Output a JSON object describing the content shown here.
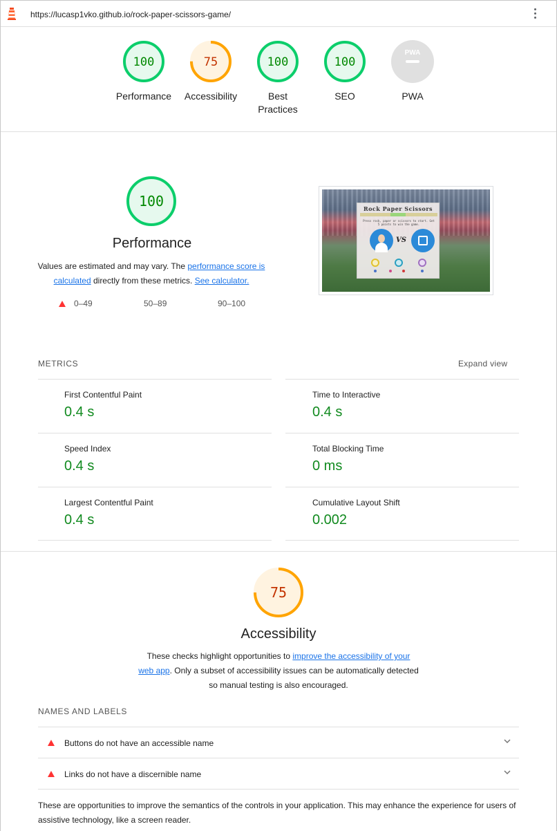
{
  "url": "https://lucasp1vko.github.io/rock-paper-scissors-game/",
  "colors": {
    "pass": "#0cce6b",
    "average": "#ffa400",
    "fail": "#ff3333",
    "pwa": "#e0e0e0"
  },
  "summary": [
    {
      "label": "Performance",
      "score": "100",
      "status": "pass"
    },
    {
      "label": "Accessibility",
      "score": "75",
      "status": "average"
    },
    {
      "label": "Best Practices",
      "score": "100",
      "status": "pass"
    },
    {
      "label": "SEO",
      "score": "100",
      "status": "pass"
    },
    {
      "label": "PWA",
      "score": "PWA",
      "status": "na"
    }
  ],
  "performance": {
    "score": "100",
    "title": "Performance",
    "desc_prefix": "Values are estimated and may vary. The ",
    "desc_link1": "performance score is calculated",
    "desc_mid": " directly from these metrics. ",
    "desc_link2": "See calculator.",
    "legend": [
      "0–49",
      "50–89",
      "90–100"
    ]
  },
  "screenshot": {
    "title": "Rock Paper Scissors",
    "text": "Press rock, paper or scissors to start. Get 5 points to win the game.",
    "vs": "VS"
  },
  "metrics": {
    "heading": "METRICS",
    "expand": "Expand view",
    "items": [
      {
        "label": "First Contentful Paint",
        "value": "0.4 s"
      },
      {
        "label": "Time to Interactive",
        "value": "0.4 s"
      },
      {
        "label": "Speed Index",
        "value": "0.4 s"
      },
      {
        "label": "Total Blocking Time",
        "value": "0 ms"
      },
      {
        "label": "Largest Contentful Paint",
        "value": "0.4 s"
      },
      {
        "label": "Cumulative Layout Shift",
        "value": "0.002"
      }
    ]
  },
  "accessibility": {
    "score": "75",
    "title": "Accessibility",
    "desc_prefix": "These checks highlight opportunities to ",
    "desc_link": "improve the accessibility of your web app",
    "desc_suffix": ". Only a subset of accessibility issues can be automatically detected so manual testing is also encouraged.",
    "group": "NAMES AND LABELS",
    "audits": [
      "Buttons do not have an accessible name",
      "Links do not have a discernible name"
    ],
    "footer": "These are opportunities to improve the semantics of the controls in your application. This may enhance the experience for users of assistive technology, like a screen reader."
  }
}
